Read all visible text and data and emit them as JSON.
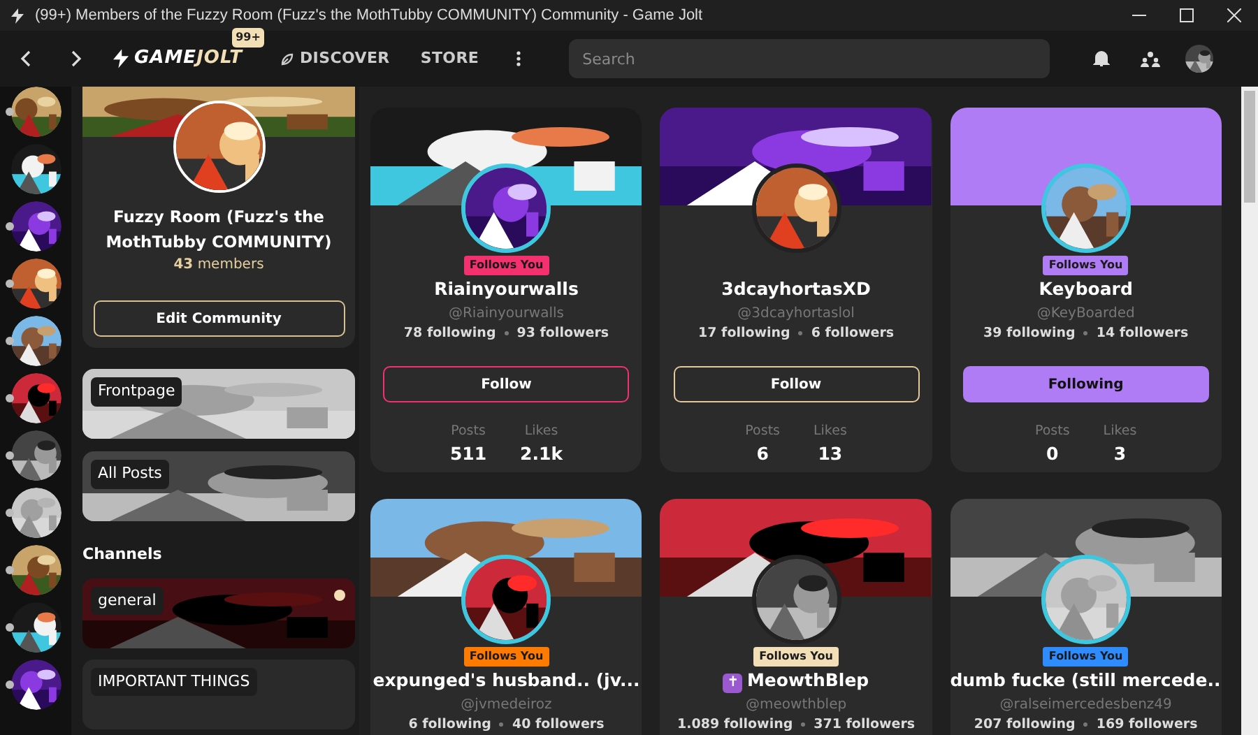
{
  "window": {
    "title": "(99+) Members of the Fuzzy Room (Fuzz's the MothTubby COMMUNITY) Community - Game Jolt"
  },
  "topbar": {
    "logo": [
      "GAME",
      "JOLT"
    ],
    "badge": "99+",
    "links": [
      "DISCOVER",
      "STORE"
    ],
    "search": {
      "placeholder": "Search"
    }
  },
  "rail": [
    {
      "unread": true
    },
    {
      "unread": false
    },
    {
      "unread": true
    },
    {
      "unread": true
    },
    {
      "unread": true
    },
    {
      "unread": true
    },
    {
      "unread": true
    },
    {
      "unread": true
    },
    {
      "unread": true
    },
    {
      "unread": true
    },
    {
      "unread": true
    }
  ],
  "community": {
    "name": "Fuzzy Room (Fuzz's the MothTubby COMMUNITY)",
    "members": "**43** members",
    "edit_button": "Edit Community",
    "feeds": [
      "Frontpage",
      "All Posts"
    ],
    "channels_heading": "Channels",
    "channels": [
      {
        "name": "general",
        "unread": true
      },
      {
        "name": "IMPORTANT THINGS",
        "unread": false
      }
    ]
  },
  "users": [
    {
      "name": "Riainyourwalls",
      "handle": "@Riainyourwalls",
      "following": "78 following",
      "followers": "93 followers",
      "badge": "Follows You",
      "color": "#f5306f",
      "button": {
        "label": "Follow",
        "following": false
      },
      "posts_label": "Posts",
      "posts": "511",
      "likes_label": "Likes",
      "likes": "2.1k"
    },
    {
      "name": "3dcayhortasXD",
      "handle": "@3dcayhortaslol",
      "following": "17 following",
      "followers": "6 followers",
      "color": "#e3c998",
      "button": {
        "label": "Follow",
        "following": false
      },
      "posts_label": "Posts",
      "posts": "6",
      "likes_label": "Likes",
      "likes": "13"
    },
    {
      "name": "Keyboard",
      "handle": "@KeyBoarded",
      "following": "39 following",
      "followers": "14 followers",
      "badge": "Follows You",
      "color": "#b07cf6",
      "banner": {
        "kind": "solid"
      },
      "button": {
        "label": "Following",
        "following": true
      },
      "posts_label": "Posts",
      "posts": "0",
      "likes_label": "Likes",
      "likes": "3"
    },
    {
      "name": "expunged's husband.. (jv...",
      "handle": "@jvmedeiroz",
      "following": "6 following",
      "followers": "40 followers",
      "badge": "Follows You",
      "color": "#ff7a00"
    },
    {
      "name_icon": "✝",
      "name": "MeowthBlep",
      "handle": "@meowthblep",
      "following": "1.089 following",
      "followers": "371 followers",
      "badge": "Follows You",
      "color": "#f2dfb8"
    },
    {
      "name": "dumb fucke (still mercede...",
      "handle": "@ralseimercedesbenz49",
      "following": "207 following",
      "followers": "169 followers",
      "badge": "Follows You",
      "color": "#2f8cff"
    }
  ]
}
